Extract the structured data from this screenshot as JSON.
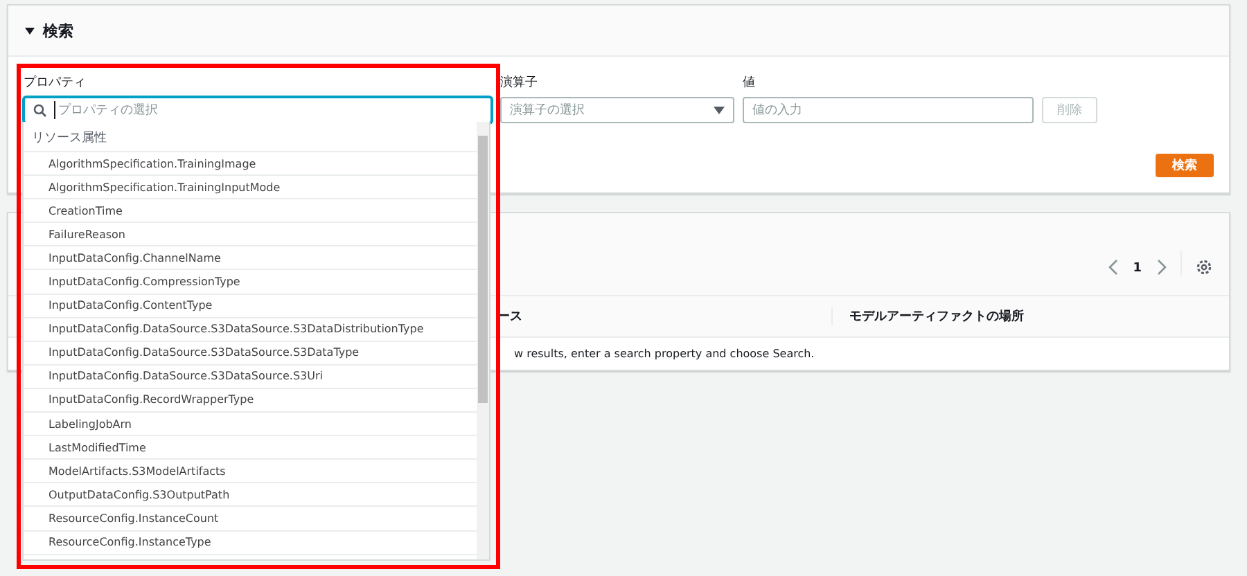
{
  "search_panel": {
    "title": "検索",
    "expanded": true,
    "property": {
      "label": "プロパティ",
      "placeholder": "プロパティの選択"
    },
    "operator": {
      "label": "演算子",
      "placeholder": "演算子の選択"
    },
    "value": {
      "label": "値",
      "placeholder": "値の入力"
    },
    "remove_button": {
      "label": "削除",
      "disabled": true
    },
    "search_button": "検索"
  },
  "results_panel": {
    "page": "1",
    "columns": [
      "ース",
      "モデルアーティファクトの場所"
    ],
    "empty_message": "w results, enter a search property and choose Search."
  },
  "property_dropdown": {
    "group": "リソース属性",
    "items": [
      "AlgorithmSpecification.TrainingImage",
      "AlgorithmSpecification.TrainingInputMode",
      "CreationTime",
      "FailureReason",
      "InputDataConfig.ChannelName",
      "InputDataConfig.CompressionType",
      "InputDataConfig.ContentType",
      "InputDataConfig.DataSource.S3DataSource.S3DataDistributionType",
      "InputDataConfig.DataSource.S3DataSource.S3DataType",
      "InputDataConfig.DataSource.S3DataSource.S3Uri",
      "InputDataConfig.RecordWrapperType",
      "LabelingJobArn",
      "LastModifiedTime",
      "ModelArtifacts.S3ModelArtifacts",
      "OutputDataConfig.S3OutputPath",
      "ResourceConfig.InstanceCount",
      "ResourceConfig.InstanceType"
    ]
  }
}
